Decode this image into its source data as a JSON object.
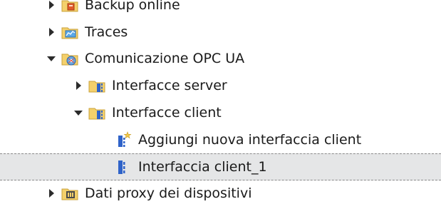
{
  "tree": {
    "items": [
      {
        "label": "Backup online",
        "icon": "backup-folder-icon",
        "state": "collapsed"
      },
      {
        "label": "Traces",
        "icon": "traces-folder-icon",
        "state": "collapsed"
      },
      {
        "label": "Comunicazione OPC UA",
        "icon": "opc-ua-folder-icon",
        "state": "expanded"
      },
      {
        "label": "Interfacce server",
        "icon": "server-interface-folder-icon",
        "state": "collapsed"
      },
      {
        "label": "Interfacce client",
        "icon": "client-interface-folder-icon",
        "state": "expanded"
      },
      {
        "label": "Aggiungi nuova interfaccia client",
        "icon": "add-client-interface-icon",
        "state": "leaf"
      },
      {
        "label": "Interfaccia client_1",
        "icon": "client-interface-icon",
        "state": "leaf",
        "selected": true
      },
      {
        "label": "Dati proxy dei dispositivi",
        "icon": "device-proxy-folder-icon",
        "state": "collapsed"
      }
    ]
  },
  "colors": {
    "selection_background": "#e5e6e7",
    "folder_yellow": "#f2c94c",
    "interface_blue": "#2f63c9"
  }
}
